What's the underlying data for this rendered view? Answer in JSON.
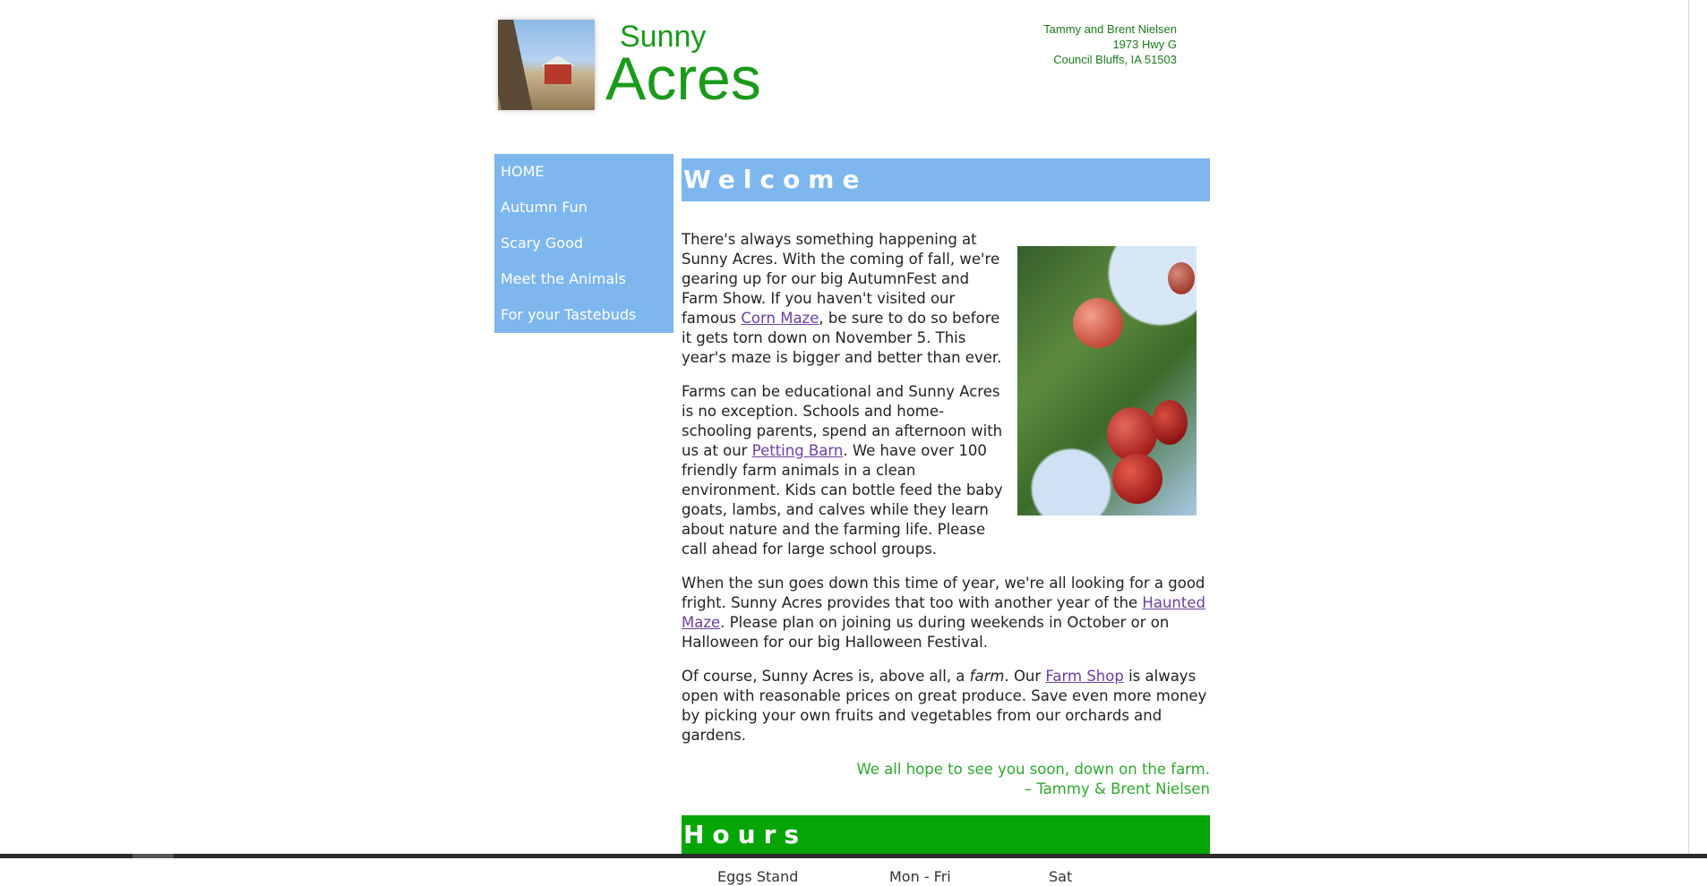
{
  "header": {
    "logo_top": "Sunny",
    "logo_main": "Acres",
    "address": [
      "Tammy and Brent Nielsen",
      "1973 Hwy G",
      "Council Bluffs, IA  51503"
    ]
  },
  "nav": {
    "items": [
      {
        "label": "HOME"
      },
      {
        "label": "Autumn Fun"
      },
      {
        "label": "Scary Good"
      },
      {
        "label": "Meet the Animals"
      },
      {
        "label": "For your Tastebuds"
      }
    ]
  },
  "welcome": {
    "title": "Welcome",
    "p1": {
      "a": "There's always something happening at Sunny Acres. With the coming of fall, we're gearing up for our big AutumnFest and Farm Show. If you haven't visited our famous ",
      "link": "Corn Maze",
      "b": ", be sure to do so before it gets torn down on November 5. This year's maze is bigger and better than ever."
    },
    "p2": {
      "a": "Farms can be educational and Sunny Acres is no exception. Schools and home-schooling parents, spend an afternoon with us at our ",
      "link": "Petting Barn",
      "b": ". We have over 100 friendly farm animals in a clean environment. Kids can bottle feed the baby goats, lambs, and calves while they learn about nature and the farming life. Please call ahead for large school groups."
    },
    "p3": {
      "a": "When the sun goes down this time of year, we're all looking for a good fright. Sunny Acres provides that too with another year of the ",
      "link": "Haunted Maze",
      "b": ". Please plan on joining us during weekends in October or on Halloween for our big Halloween Festival."
    },
    "p4": {
      "a": "Of course, Sunny Acres is, above all, a ",
      "em": "farm",
      "b": ". Our ",
      "link": "Farm Shop",
      "c": " is always open with reasonable prices on great produce. Save even more money by picking your own fruits and vegetables from our orchards and gardens."
    },
    "signoff_1": "We all hope to see you soon, down on the farm.",
    "signoff_2": "– Tammy & Brent Nielsen"
  },
  "hours": {
    "title": "Hours",
    "cols": [
      "Eggs Stand",
      "Mon - Fri",
      "Sat"
    ]
  },
  "colors": {
    "accent_blue": "#7db7ee",
    "accent_green": "#05a505",
    "logo_green": "#1a9a1a",
    "link": "#6b3fa0"
  }
}
